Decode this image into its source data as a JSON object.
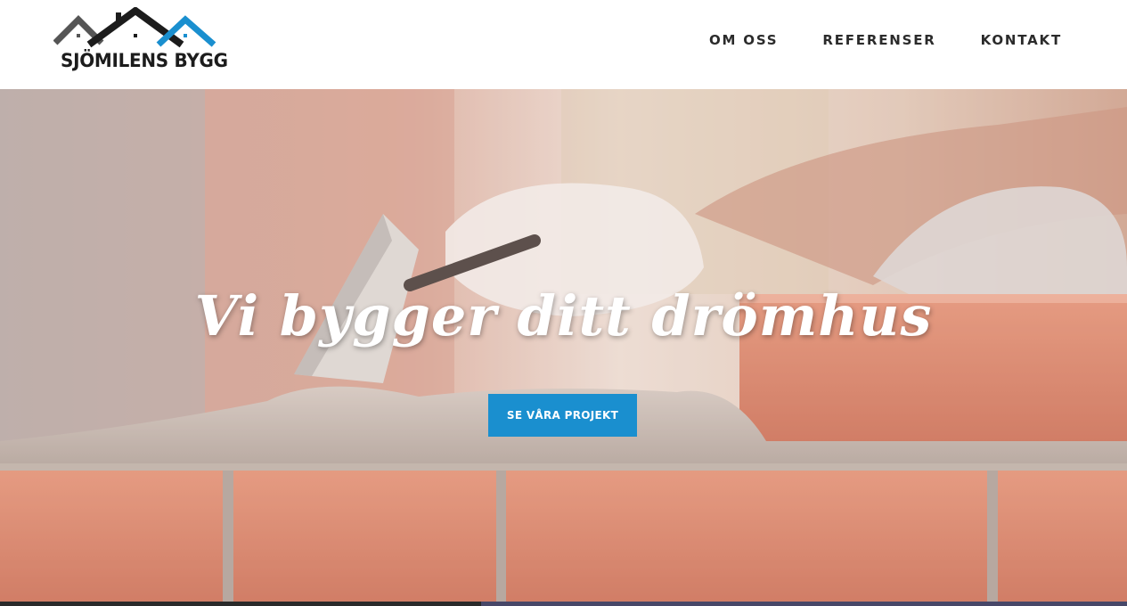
{
  "brand": {
    "name": "SJÖMILENS BYGG",
    "colors": {
      "dark_roof": "#1c1c1c",
      "grey_roof": "#555555",
      "blue_roof": "#1a8fcf"
    }
  },
  "nav": {
    "items": [
      {
        "label": "OM OSS"
      },
      {
        "label": "REFERENSER"
      },
      {
        "label": "KONTAKT"
      }
    ]
  },
  "hero": {
    "heading": "Vi bygger ditt drömhus",
    "cta_label": "SE VÅRA PROJEKT",
    "image": "bricklayer-laying-bricks-photo",
    "colors": {
      "cta": "#1a8fcf",
      "heading": "#ffffff"
    }
  }
}
